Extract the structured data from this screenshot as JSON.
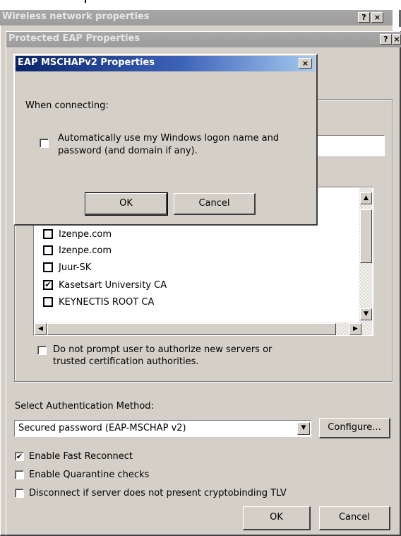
{
  "windows": {
    "wireless": {
      "title": "Wireless network properties",
      "help_btn": "?",
      "close_btn": "×"
    },
    "peap": {
      "title": "Protected EAP Properties",
      "help_btn": "?",
      "close_btn": "×"
    }
  },
  "mschap_dialog": {
    "title": "EAP MSCHAPv2 Properties",
    "close_btn": "×",
    "when_connecting": "When connecting:",
    "auto_logon_label": "Automatically use my Windows logon name and password (and domain if any).",
    "auto_logon_checked": false,
    "ok_label": "OK",
    "cancel_label": "Cancel"
  },
  "cert_list": {
    "items": [
      {
        "label": "Izenpe.com",
        "checked": false
      },
      {
        "label": "Izenpe.com",
        "checked": false
      },
      {
        "label": "Juur-SK",
        "checked": false
      },
      {
        "label": "Kasetsart University CA",
        "checked": true
      },
      {
        "label": "KEYNECTIS ROOT CA",
        "checked": false
      }
    ],
    "scroll_up": "▲",
    "scroll_down": "▼",
    "scroll_left": "◀",
    "scroll_right": "▶"
  },
  "do_not_prompt_label": "Do not prompt user to authorize new servers or trusted certification authorities.",
  "auth_method": {
    "label": "Select Authentication Method:",
    "selected": "Secured password (EAP-MSCHAP v2)",
    "configure_label": "Configure..."
  },
  "options": [
    {
      "label": "Enable Fast Reconnect",
      "checked": true
    },
    {
      "label": "Enable Quarantine checks",
      "checked": false
    },
    {
      "label": "Disconnect if server does not present cryptobinding TLV",
      "checked": false
    }
  ],
  "peap_ok_label": "OK",
  "peap_cancel_label": "Cancel",
  "check_mark": "✔"
}
